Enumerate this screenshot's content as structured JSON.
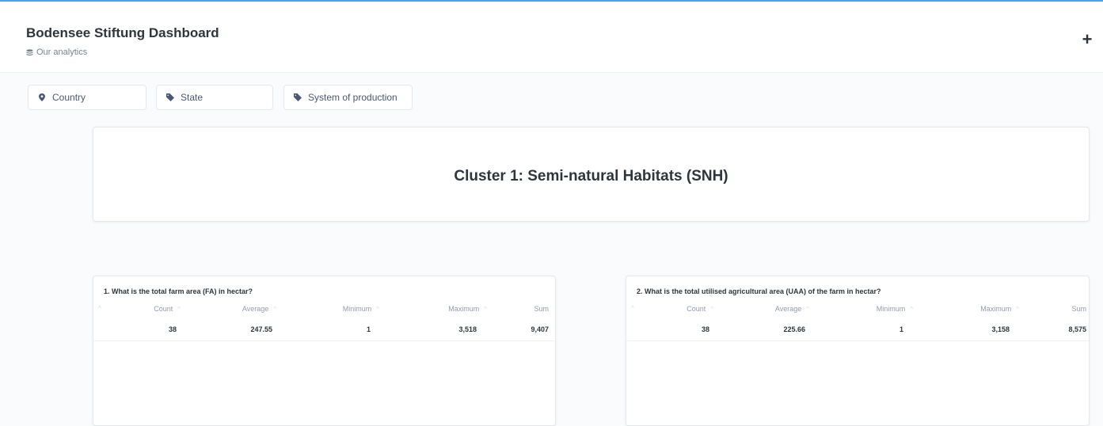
{
  "header": {
    "title": "Bodensee Stiftung Dashboard",
    "collection_label": "Our analytics",
    "add_label": "+"
  },
  "filters": [
    {
      "label": "Country",
      "icon": "location-pin-icon"
    },
    {
      "label": "State",
      "icon": "tag-icon"
    },
    {
      "label": "System of production",
      "icon": "tag-icon"
    }
  ],
  "heading_card": {
    "text": "Cluster 1: Semi-natural Habitats (SNH)"
  },
  "questions": [
    {
      "title": "1. What is the total farm area (FA) in hectar?",
      "columns": [
        "Count",
        "Average",
        "Minimum",
        "Maximum",
        "Sum"
      ],
      "values": [
        "38",
        "247.55",
        "1",
        "3,518",
        "9,407"
      ]
    },
    {
      "title": "2. What is the total utilised agricultural area (UAA) of the farm in hectar?",
      "columns": [
        "Count",
        "Average",
        "Minimum",
        "Maximum",
        "Sum"
      ],
      "values": [
        "38",
        "225.66",
        "1",
        "3,158",
        "8,575"
      ]
    }
  ],
  "colors": {
    "accent": "#509ee3",
    "text_dark": "#2e353b",
    "text_muted": "#949aab"
  }
}
